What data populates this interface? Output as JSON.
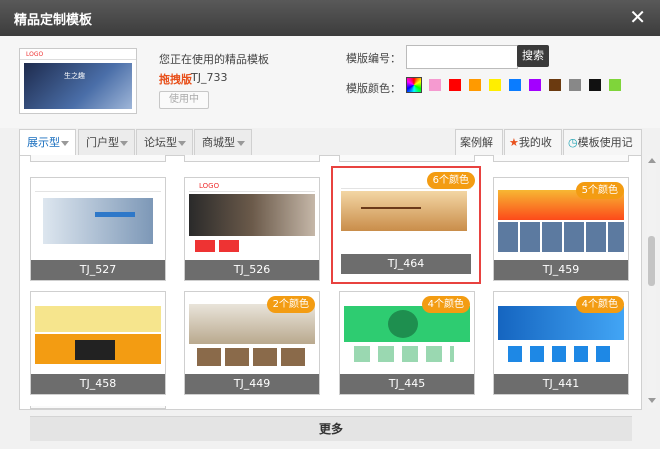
{
  "dialog": {
    "title": "精品定制模板",
    "close_icon": "close-icon"
  },
  "current": {
    "using_label": "您正在使用的精品模板",
    "type": "拖拽版",
    "code": "TJ_733",
    "in_use_button": "使用中",
    "thumb_logo": "LOGO",
    "thumb_text": "生之趣"
  },
  "search": {
    "code_label": "模版编号：",
    "code_value": "",
    "button": "搜索"
  },
  "colors": {
    "label": "模版颜色：",
    "swatches": [
      "#f59ad0",
      "#ff0000",
      "#ff9a00",
      "#ffee00",
      "#0a7cff",
      "#a300ff",
      "#6b3a10",
      "#888888",
      "#111111",
      "#7fd53a"
    ]
  },
  "tabs": [
    {
      "label": "展示型",
      "active": true
    },
    {
      "label": "门户型",
      "active": false
    },
    {
      "label": "论坛型",
      "active": false
    },
    {
      "label": "商城型",
      "active": false
    }
  ],
  "right_tabs": {
    "cases": "案例解析",
    "favorites": "我的收藏",
    "history": "模板使用记录"
  },
  "templates": [
    {
      "code": "TJ_527",
      "badge": "",
      "selected": false
    },
    {
      "code": "TJ_526",
      "badge": "",
      "selected": false
    },
    {
      "code": "TJ_464",
      "badge": "6个颜色",
      "selected": true
    },
    {
      "code": "TJ_459",
      "badge": "5个颜色",
      "selected": false
    },
    {
      "code": "TJ_458",
      "badge": "",
      "selected": false
    },
    {
      "code": "TJ_449",
      "badge": "2个颜色",
      "selected": false
    },
    {
      "code": "TJ_445",
      "badge": "4个颜色",
      "selected": false
    },
    {
      "code": "TJ_441",
      "badge": "4个颜色",
      "selected": false
    }
  ],
  "thumb_logo": "LOGO",
  "more_button": "更多"
}
